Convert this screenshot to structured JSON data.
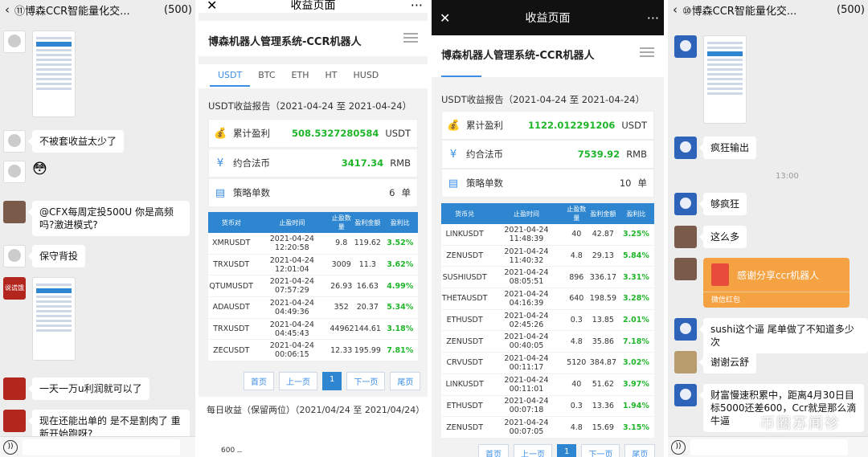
{
  "left_chat": {
    "title": "⑪博森CCR智能量化交...",
    "count": "(500)",
    "messages": [
      {
        "text": "不被套收益太少了"
      },
      {
        "text": "😳"
      },
      {
        "text": "@CFX每周定投500U 你是高频吗?激进模式?"
      },
      {
        "text": "保守背投"
      },
      {
        "text": "一天一万u利润就可以了"
      },
      {
        "text": "现在还能出单的 是不是割肉了 重新开始跑呀?"
      }
    ],
    "avatar_label": "说谎饿"
  },
  "app1": {
    "page_title": "收益页面",
    "brand": "博森机器人管理系统-CCR机器人",
    "tabs": [
      "USDT",
      "BTC",
      "ETH",
      "HT",
      "HUSD"
    ],
    "report_title": "USDT收益报告（2021-04-24 至 2021-04-24）",
    "stats": [
      {
        "label": "累计盈利",
        "value": "508.5327280584",
        "unit": "USDT",
        "icon": "money-bag-icon"
      },
      {
        "label": "约合法币",
        "value": "3417.34",
        "unit": "RMB",
        "icon": "yen-icon"
      },
      {
        "label": "策略单数",
        "value": "6",
        "unit": "单",
        "icon": "document-icon"
      }
    ],
    "headers": [
      "货币对",
      "止盈时间",
      "止盈数量",
      "盈利金额",
      "盈利比"
    ],
    "rows": [
      [
        "XMRUSDT",
        "2021-04-24 12:20:58",
        "9.8",
        "119.62",
        "3.52%"
      ],
      [
        "TRXUSDT",
        "2021-04-24 12:01:04",
        "3009",
        "11.3",
        "3.62%"
      ],
      [
        "QTUMUSDT",
        "2021-04-24 07:57:29",
        "26.93",
        "16.63",
        "4.99%"
      ],
      [
        "ADAUSDT",
        "2021-04-24 04:49:36",
        "352",
        "20.37",
        "5.34%"
      ],
      [
        "TRXUSDT",
        "2021-04-24 04:45:43",
        "44962",
        "144.61",
        "3.18%"
      ],
      [
        "ZECUSDT",
        "2021-04-24 00:06:15",
        "12.33",
        "195.99",
        "7.81%"
      ]
    ],
    "pager": [
      "首页",
      "上一页",
      "1",
      "下一页",
      "尾页"
    ],
    "daily_title": "每日收益（保留两位）（2021/04/24 至 2021/04/24）",
    "y_tick": "600"
  },
  "app2": {
    "page_title": "收益页面",
    "brand": "博森机器人管理系统-CCR机器人",
    "report_title": "USDT收益报告（2021-04-24 至 2021-04-24）",
    "stats": [
      {
        "label": "累计盈利",
        "value": "1122.012291206",
        "unit": "USDT",
        "icon": "money-bag-icon"
      },
      {
        "label": "约合法币",
        "value": "7539.92",
        "unit": "RMB",
        "icon": "yen-icon"
      },
      {
        "label": "策略单数",
        "value": "10",
        "unit": "单",
        "icon": "document-icon"
      }
    ],
    "headers": [
      "货币兑",
      "止盈时间",
      "止盈数量",
      "盈利金额",
      "盈利比"
    ],
    "rows": [
      [
        "LINKUSDT",
        "2021-04-24 11:48:39",
        "40",
        "42.87",
        "3.25%"
      ],
      [
        "ZENUSDT",
        "2021-04-24 11:40:32",
        "4.8",
        "29.13",
        "5.84%"
      ],
      [
        "SUSHIUSDT",
        "2021-04-24 08:05:51",
        "896",
        "336.17",
        "3.31%"
      ],
      [
        "THETAUSDT",
        "2021-04-24 04:16:39",
        "640",
        "198.59",
        "3.28%"
      ],
      [
        "ETHUSDT",
        "2021-04-24 02:45:26",
        "0.3",
        "13.85",
        "2.01%"
      ],
      [
        "ZENUSDT",
        "2021-04-24 00:40:05",
        "4.8",
        "35.86",
        "7.18%"
      ],
      [
        "CRVUSDT",
        "2021-04-24 00:11:17",
        "5120",
        "384.87",
        "3.02%"
      ],
      [
        "LINKUSDT",
        "2021-04-24 00:11:01",
        "40",
        "51.62",
        "3.97%"
      ],
      [
        "ETHUSDT",
        "2021-04-24 00:07:18",
        "0.3",
        "13.36",
        "1.94%"
      ],
      [
        "ZENUSDT",
        "2021-04-24 00:07:05",
        "4.8",
        "15.69",
        "3.15%"
      ]
    ],
    "pager": [
      "首页",
      "上一页",
      "1",
      "下一页",
      "尾页"
    ]
  },
  "right_chat": {
    "title": "⑩博森CCR智能量化交...",
    "count": "(500)",
    "time": "13:00",
    "messages": [
      {
        "text": "疯狂输出"
      },
      {
        "text": "够疯狂"
      },
      {
        "text": "这么多"
      },
      {
        "text": "sushi这个逼 尾单做了不知道多少次"
      },
      {
        "text": "谢谢云舒"
      },
      {
        "text": "财富慢速积累中，距离4月30日目标5000还差600，Ccr就是那么滴牛逼"
      }
    ],
    "red_packet": {
      "text": "感谢分享ccr机器人",
      "caption": "微信红包"
    },
    "watermark": "币圈苏闻袗"
  }
}
